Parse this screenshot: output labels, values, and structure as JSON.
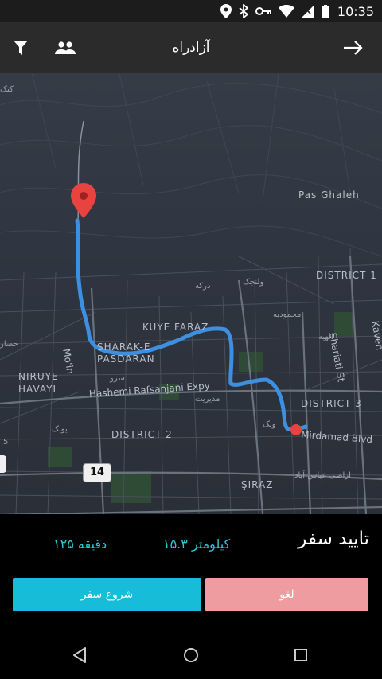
{
  "status_bar": {
    "time": "10:35",
    "icons": [
      "location-icon",
      "bluetooth-icon",
      "key-icon",
      "wifi-icon",
      "no-signal-icon",
      "battery-icon"
    ]
  },
  "app_bar": {
    "title": "آزادراه",
    "left_icons": [
      "filter-icon",
      "people-icon"
    ],
    "right_icon": "arrow-forward-icon"
  },
  "map": {
    "labels": {
      "pas_ghaleh": "Pas Ghaleh",
      "district_1": "DISTRICT 1",
      "district_2": "DISTRICT 2",
      "district_3": "DISTRICT 3",
      "kuye_faraz": "KUYE FARAZ",
      "sharak_e": "SHARAK-E",
      "pasdaran": "PASDARAN",
      "niruye": "NIRUYE",
      "havayi": "HAVAYI",
      "hashemi": "Hashemi Rafsanjani Expy",
      "mirdamad": "Mirdamad Blvd",
      "shariati": "Shariati St",
      "moin": "Mo'in",
      "shiraz": "ŞIRAZ",
      "kaveh": "Kaveh",
      "fa_1": "ولنجک",
      "fa_2": "درکه",
      "fa_3": "محمودیه",
      "fa_4": "الهیه",
      "fa_5": "سرو",
      "fa_6": "مدیریت",
      "fa_7": "ونک",
      "fa_8": "یونک",
      "fa_9": "اراضی عباس آباد",
      "fa_10": "حصار",
      "fa_11": "کنک",
      "fa_12": "5",
      "road_14": "14"
    },
    "route_color": "#3d8fe0",
    "pin_color": "#e8433f"
  },
  "trip": {
    "title": "تایید سفر",
    "distance": "۱۵.۳ کیلومتر",
    "duration": "۱۲۵ دقیقه"
  },
  "buttons": {
    "start": "شروع سفر",
    "cancel": "لغو"
  },
  "nav_bar": {
    "icons": [
      "back-triangle-icon",
      "home-circle-icon",
      "recents-square-icon"
    ]
  }
}
